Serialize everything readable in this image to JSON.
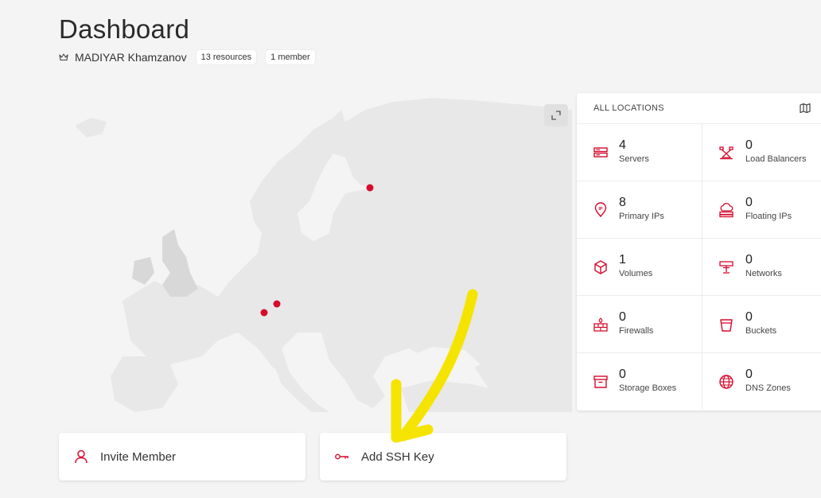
{
  "page": {
    "title": "Dashboard",
    "owner": "MADIYAR Khamzanov",
    "resources_badge": "13 resources",
    "members_badge": "1 member"
  },
  "map": {
    "markers": [
      "marker-finland",
      "marker-germany-1",
      "marker-germany-2"
    ],
    "expand_icon": "expand-icon"
  },
  "locations": {
    "header": "ALL LOCATIONS",
    "items": [
      {
        "count": "4",
        "label": "Servers",
        "icon": "server-icon"
      },
      {
        "count": "0",
        "label": "Load Balancers",
        "icon": "load-balancer-icon"
      },
      {
        "count": "8",
        "label": "Primary IPs",
        "icon": "primary-ip-icon"
      },
      {
        "count": "0",
        "label": "Floating IPs",
        "icon": "floating-ip-icon"
      },
      {
        "count": "1",
        "label": "Volumes",
        "icon": "volume-icon"
      },
      {
        "count": "0",
        "label": "Networks",
        "icon": "network-icon"
      },
      {
        "count": "0",
        "label": "Firewalls",
        "icon": "firewall-icon"
      },
      {
        "count": "0",
        "label": "Buckets",
        "icon": "bucket-icon"
      },
      {
        "count": "0",
        "label": "Storage Boxes",
        "icon": "storage-box-icon"
      },
      {
        "count": "0",
        "label": "DNS Zones",
        "icon": "dns-zone-icon"
      }
    ]
  },
  "actions": {
    "invite_member": "Invite Member",
    "add_ssh_key": "Add SSH Key"
  },
  "colors": {
    "accent": "#d50c2d",
    "map_land": "#e6e6e6",
    "annotation": "#f5e400"
  }
}
